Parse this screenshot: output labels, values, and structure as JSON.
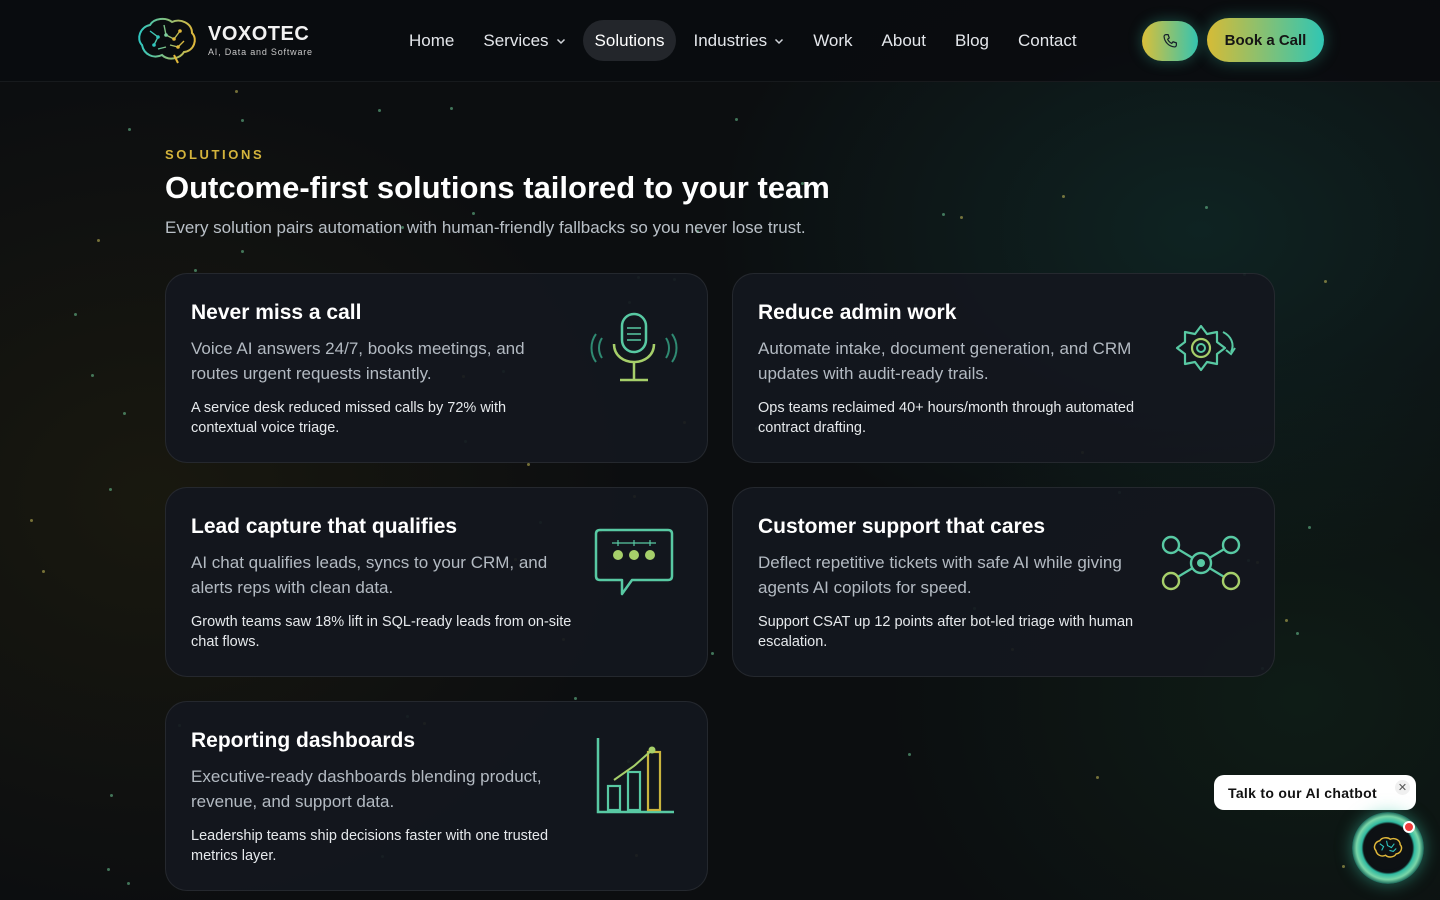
{
  "brand": {
    "name": "VOXOTEC",
    "tagline": "AI, Data and Software"
  },
  "nav": {
    "items": [
      {
        "label": "Home",
        "dropdown": false,
        "active": false
      },
      {
        "label": "Services",
        "dropdown": true,
        "active": false
      },
      {
        "label": "Solutions",
        "dropdown": false,
        "active": true
      },
      {
        "label": "Industries",
        "dropdown": true,
        "active": false
      },
      {
        "label": "Work",
        "dropdown": false,
        "active": false
      },
      {
        "label": "About",
        "dropdown": false,
        "active": false
      },
      {
        "label": "Blog",
        "dropdown": false,
        "active": false
      },
      {
        "label": "Contact",
        "dropdown": false,
        "active": false
      }
    ],
    "book_label": "Book a Call"
  },
  "section": {
    "eyebrow": "SOLUTIONS",
    "title": "Outcome-first solutions tailored to your team",
    "subtitle": "Every solution pairs automation with human-friendly fallbacks so you never lose trust."
  },
  "cards": [
    {
      "title": "Never miss a call",
      "desc": "Voice AI answers 24/7, books meetings, and routes urgent requests instantly.",
      "proof": "A service desk reduced missed calls by 72% with contextual voice triage.",
      "icon": "microphone-icon"
    },
    {
      "title": "Reduce admin work",
      "desc": "Automate intake, document generation, and CRM updates with audit-ready trails.",
      "proof": "Ops teams reclaimed 40+ hours/month through automated contract drafting.",
      "icon": "gear-cycle-icon"
    },
    {
      "title": "Lead capture that qualifies",
      "desc": "AI chat qualifies leads, syncs to your CRM, and alerts reps with clean data.",
      "proof": "Growth teams saw 18% lift in SQL-ready leads from on-site chat flows.",
      "icon": "chat-bubble-icon"
    },
    {
      "title": "Customer support that cares",
      "desc": "Deflect repetitive tickets with safe AI while giving agents AI copilots for speed.",
      "proof": "Support CSAT up 12 points after bot-led triage with human escalation.",
      "icon": "network-nodes-icon"
    },
    {
      "title": "Reporting dashboards",
      "desc": "Executive-ready dashboards blending product, revenue, and support data.",
      "proof": "Leadership teams ship decisions faster with one trusted metrics layer.",
      "icon": "bar-chart-icon"
    }
  ],
  "chatbot": {
    "label": "Talk to our AI chatbot"
  },
  "colors": {
    "accent_gold": "#d4b43c",
    "accent_teal": "#35c4b0",
    "background": "#0c0e10",
    "card_bg": "#14171e"
  }
}
